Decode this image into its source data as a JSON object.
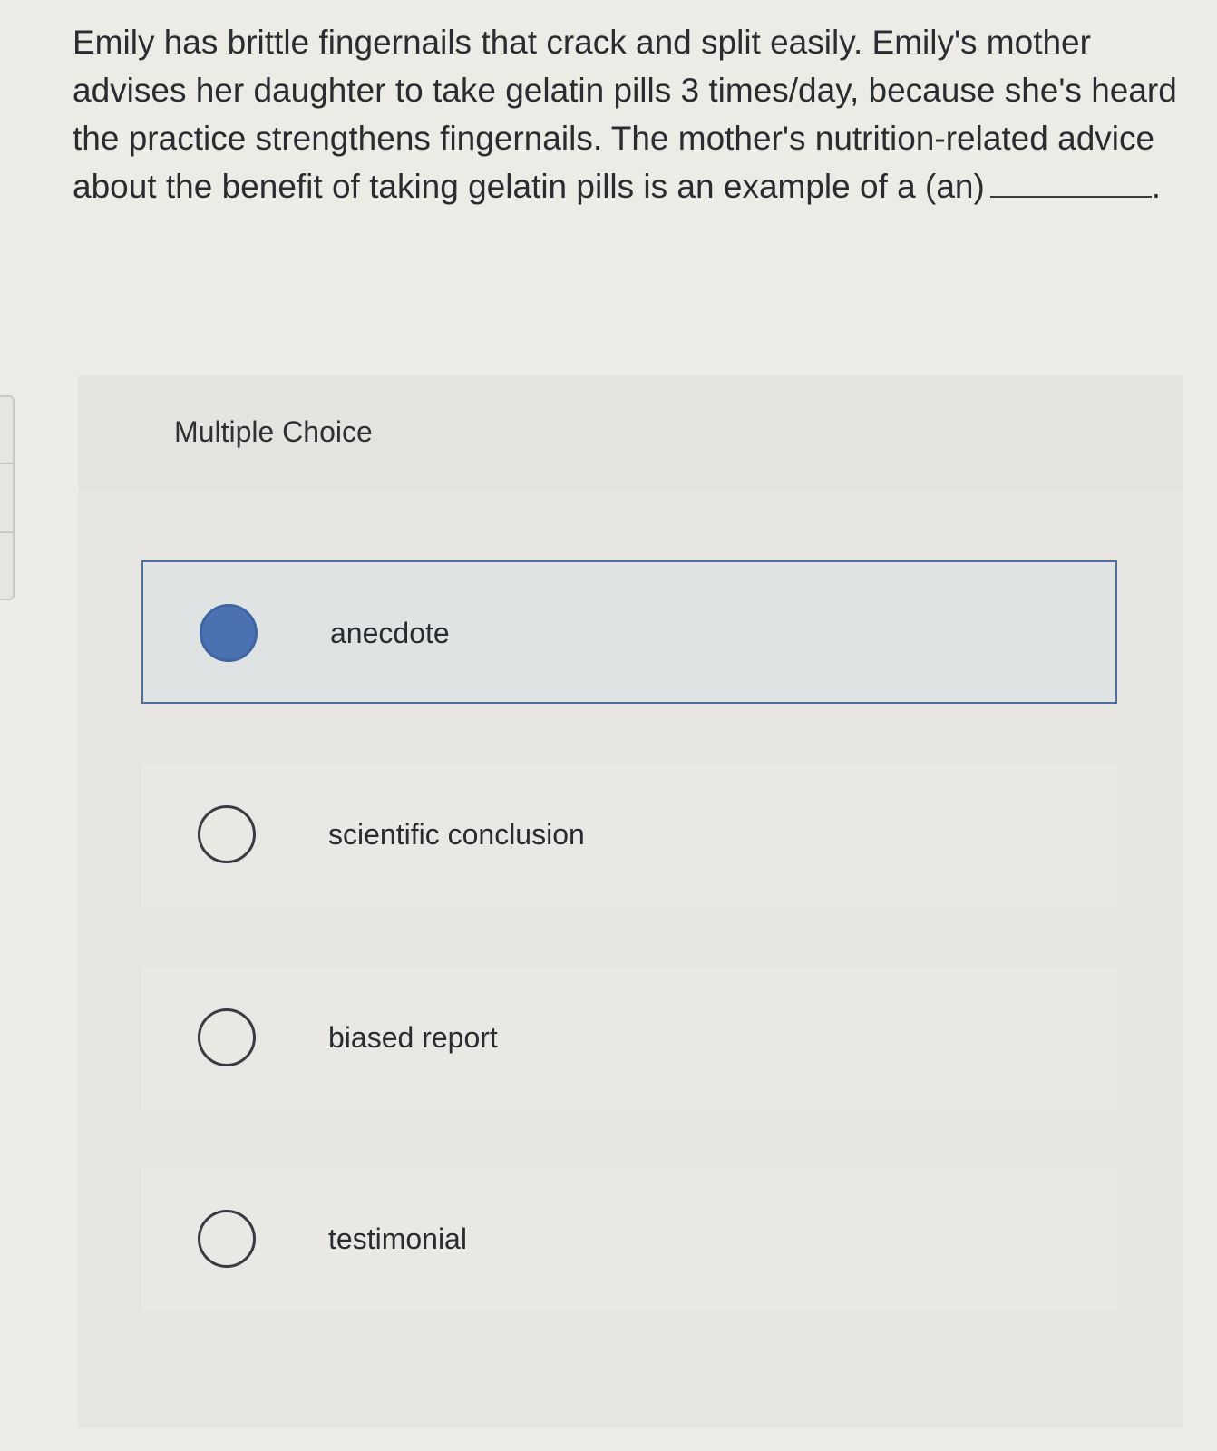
{
  "question": {
    "text": "Emily has brittle fingernails that crack and split easily. Emily's mother advises her daughter to take gelatin pills 3 times/day, because she's heard the practice strengthens fingernails. The mother's nutrition-related advice about the benefit of taking gelatin pills is an example of a (an)",
    "blank_suffix": "."
  },
  "panel": {
    "header": "Multiple Choice"
  },
  "options": [
    {
      "label": "anecdote",
      "selected": true
    },
    {
      "label": "scientific conclusion",
      "selected": false
    },
    {
      "label": "biased report",
      "selected": false
    },
    {
      "label": "testimonial",
      "selected": false
    }
  ],
  "colors": {
    "selected_fill": "#4a72b3",
    "selected_border": "#4f6e9d",
    "background": "#ecebe6"
  }
}
